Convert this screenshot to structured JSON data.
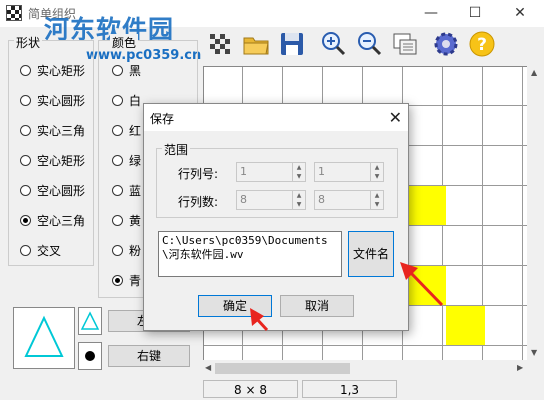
{
  "window": {
    "title": "简单组织",
    "watermark": "河东软件园",
    "watermark_url": "www.pc0359.cn",
    "controls": {
      "minimize": "—",
      "maximize": "☐",
      "close": "✕"
    }
  },
  "toolbar": {
    "icons": [
      "checker-icon",
      "open-folder-icon",
      "save-disk-icon",
      "zoom-in-icon",
      "zoom-out-icon",
      "copy-window-icon",
      "gear-icon",
      "help-icon"
    ]
  },
  "shape_panel": {
    "label": "形状",
    "options": [
      "实心矩形",
      "实心圆形",
      "实心三角",
      "空心矩形",
      "空心圆形",
      "空心三角",
      "交叉"
    ],
    "selected": "空心三角"
  },
  "color_panel": {
    "label": "颜色",
    "options": [
      "黑",
      "白",
      "红",
      "绿",
      "蓝",
      "黄",
      "粉",
      "青"
    ],
    "selected": "青"
  },
  "buttons": {
    "left_key": "左键",
    "right_key": "右键"
  },
  "grid": {
    "highlight_color": "#ffff00",
    "accent_color": "#00c8d6"
  },
  "statusbar": {
    "size": "8 × 8",
    "position": "1,3"
  },
  "save_dialog": {
    "title": "保存",
    "close": "✕",
    "range_label": "范围",
    "row_label": "行列号:",
    "count_label": "行列数:",
    "row_from": "1",
    "row_to": "1",
    "count_from": "8",
    "count_to": "8",
    "path": "C:\\Users\\pc0359\\Documents\\河东软件园.wv",
    "filename_button": "文件名",
    "ok_button": "确定",
    "cancel_button": "取消"
  }
}
